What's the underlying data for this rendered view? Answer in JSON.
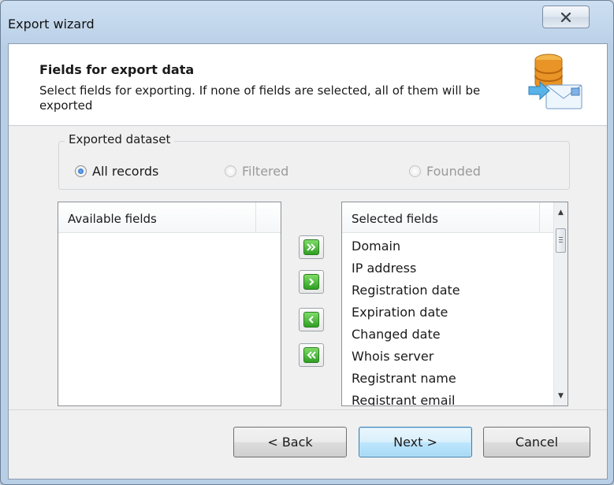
{
  "window": {
    "title": "Export wizard",
    "close_symbol": "×"
  },
  "header": {
    "title": "Fields for export data",
    "description": "Select fields for exporting. If none of fields are selected, all of them will be exported",
    "icon": "database-export-icon"
  },
  "exported_dataset": {
    "legend": "Exported dataset",
    "options": [
      {
        "label": "All records",
        "selected": true,
        "enabled": true
      },
      {
        "label": "Filtered",
        "selected": false,
        "enabled": false
      },
      {
        "label": "Founded",
        "selected": false,
        "enabled": false
      }
    ]
  },
  "available_fields": {
    "header": "Available fields",
    "items": []
  },
  "selected_fields": {
    "header": "Selected fields",
    "items": [
      "Domain",
      "IP address",
      "Registration date",
      "Expiration date",
      "Changed date",
      "Whois server",
      "Registrant name",
      "Registrant email"
    ]
  },
  "move_buttons": {
    "add_all": "»",
    "add": "›",
    "remove": "‹",
    "remove_all": "«"
  },
  "footer": {
    "back_label": "< Back",
    "next_label": "Next >",
    "cancel_label": "Cancel"
  },
  "colors": {
    "accent_green": "#2f9f23",
    "default_button_border": "#3c7fb1"
  }
}
